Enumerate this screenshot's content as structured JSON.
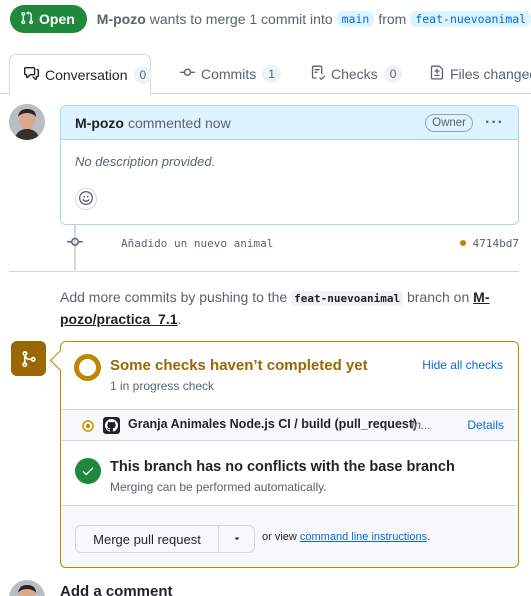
{
  "header": {
    "state": "Open",
    "author": "M-pozo",
    "text_before": "wants to merge 1 commit into",
    "base_branch": "main",
    "text_middle": "from",
    "head_branch": "feat-nuevoanimal"
  },
  "tabs": [
    {
      "label": "Conversation",
      "count": "0"
    },
    {
      "label": "Commits",
      "count": "1"
    },
    {
      "label": "Checks",
      "count": "0"
    },
    {
      "label": "Files changed",
      "count": ""
    }
  ],
  "comment": {
    "author": "M-pozo",
    "action": "commented now",
    "role": "Owner",
    "body": "No description provided."
  },
  "commit": {
    "message": "Añadido un nuevo animal",
    "sha": "4714bd7"
  },
  "hint": {
    "before": "Add more commits by pushing to the",
    "branch": "feat-nuevoanimal",
    "middle": "branch on",
    "repo": "M-pozo/practica_7.1",
    "after": "."
  },
  "merge": {
    "checks_title": "Some checks haven’t completed yet",
    "checks_sub": "1 in progress check",
    "hide_label": "Hide all checks",
    "check_name": "Granja Animales Node.js CI / build (pull_request)",
    "check_status": "In...",
    "details_label": "Details",
    "conflict_title": "This branch has no conflicts with the base branch",
    "conflict_sub": "Merging can be performed automatically.",
    "merge_label": "Merge pull request",
    "or_view": "or view",
    "cli_link": "command line instructions",
    "period": "."
  },
  "footer": {
    "add_comment": "Add a comment"
  },
  "colors": {
    "open_green": "#1f883d",
    "pending_yellow": "#bf8700",
    "link_blue": "#0969da"
  }
}
